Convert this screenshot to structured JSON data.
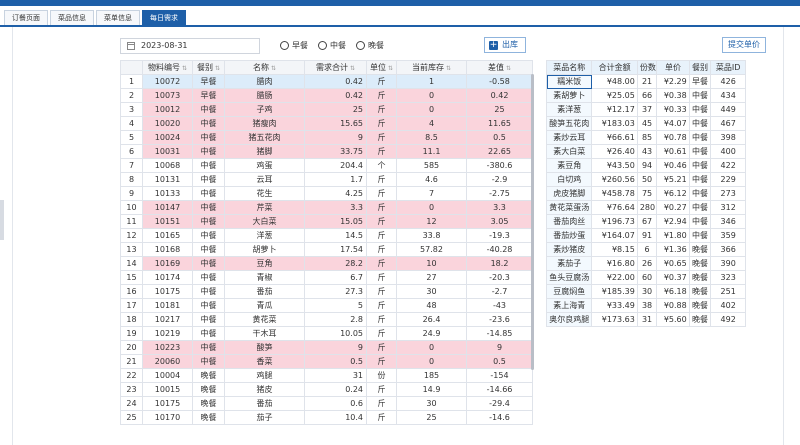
{
  "tabs": [
    {
      "label": "订餐页面"
    },
    {
      "label": "菜品信息"
    },
    {
      "label": "菜单信息"
    },
    {
      "label": "每日需求"
    }
  ],
  "date": {
    "value": "2023-08-31"
  },
  "meals": {
    "options": [
      "早餐",
      "中餐",
      "晚餐"
    ]
  },
  "toolbar": {
    "export_label": "出库",
    "submit_label": "提交单价"
  },
  "colors": {
    "accent": "#1e5fa8",
    "pink_row": "#fad4dc",
    "blue_row": "#dcecfa"
  },
  "demand_table": {
    "columns": [
      "",
      "物料编号",
      "餐别",
      "名称",
      "需求合计",
      "单位",
      "当前库存",
      "差值"
    ],
    "rows": [
      [
        "1",
        "10072",
        "早餐",
        "腊肉",
        "0.42",
        "斤",
        "1",
        "-0.58"
      ],
      [
        "2",
        "10073",
        "早餐",
        "腊肠",
        "0.42",
        "斤",
        "0",
        "0.42"
      ],
      [
        "3",
        "10012",
        "中餐",
        "子鸡",
        "25",
        "斤",
        "0",
        "25"
      ],
      [
        "4",
        "10020",
        "中餐",
        "猪瘦肉",
        "15.65",
        "斤",
        "4",
        "11.65"
      ],
      [
        "5",
        "10024",
        "中餐",
        "猪五花肉",
        "9",
        "斤",
        "8.5",
        "0.5"
      ],
      [
        "6",
        "10031",
        "中餐",
        "猪脚",
        "33.75",
        "斤",
        "11.1",
        "22.65"
      ],
      [
        "7",
        "10068",
        "中餐",
        "鸡蛋",
        "204.4",
        "个",
        "585",
        "-380.6"
      ],
      [
        "8",
        "10131",
        "中餐",
        "云耳",
        "1.7",
        "斤",
        "4.6",
        "-2.9"
      ],
      [
        "9",
        "10133",
        "中餐",
        "花生",
        "4.25",
        "斤",
        "7",
        "-2.75"
      ],
      [
        "10",
        "10147",
        "中餐",
        "芹菜",
        "3.3",
        "斤",
        "0",
        "3.3"
      ],
      [
        "11",
        "10151",
        "中餐",
        "大白菜",
        "15.05",
        "斤",
        "12",
        "3.05"
      ],
      [
        "12",
        "10165",
        "中餐",
        "洋葱",
        "14.5",
        "斤",
        "33.8",
        "-19.3"
      ],
      [
        "13",
        "10168",
        "中餐",
        "胡萝卜",
        "17.54",
        "斤",
        "57.82",
        "-40.28"
      ],
      [
        "14",
        "10169",
        "中餐",
        "豆角",
        "28.2",
        "斤",
        "10",
        "18.2"
      ],
      [
        "15",
        "10174",
        "中餐",
        "青椒",
        "6.7",
        "斤",
        "27",
        "-20.3"
      ],
      [
        "16",
        "10175",
        "中餐",
        "番茄",
        "27.3",
        "斤",
        "30",
        "-2.7"
      ],
      [
        "17",
        "10181",
        "中餐",
        "青瓜",
        "5",
        "斤",
        "48",
        "-43"
      ],
      [
        "18",
        "10217",
        "中餐",
        "黄花菜",
        "2.8",
        "斤",
        "26.4",
        "-23.6"
      ],
      [
        "19",
        "10219",
        "中餐",
        "干木耳",
        "10.05",
        "斤",
        "24.9",
        "-14.85"
      ],
      [
        "20",
        "10223",
        "中餐",
        "酸笋",
        "9",
        "斤",
        "0",
        "9"
      ],
      [
        "21",
        "20060",
        "中餐",
        "香菜",
        "0.5",
        "斤",
        "0",
        "0.5"
      ],
      [
        "22",
        "10004",
        "晚餐",
        "鸡腿",
        "31",
        "份",
        "185",
        "-154"
      ],
      [
        "23",
        "10015",
        "晚餐",
        "猪皮",
        "0.24",
        "斤",
        "14.9",
        "-14.66"
      ],
      [
        "24",
        "10175",
        "晚餐",
        "番茄",
        "0.6",
        "斤",
        "30",
        "-29.4"
      ],
      [
        "25",
        "10170",
        "晚餐",
        "茄子",
        "10.4",
        "斤",
        "25",
        "-14.6"
      ]
    ],
    "row_states": [
      "blue",
      "pink",
      "pink",
      "pink",
      "pink",
      "pink",
      "",
      "",
      "",
      "pink",
      "pink",
      "",
      "",
      "pink",
      "",
      "",
      "",
      "",
      "",
      "pink",
      "pink",
      "",
      "",
      "",
      ""
    ]
  },
  "dish_table": {
    "columns": [
      "菜品名称",
      "合计金额",
      "份数",
      "单价",
      "餐别",
      "菜品ID"
    ],
    "rows": [
      [
        "糯米饭",
        "¥48.00",
        "21",
        "¥2.29",
        "早餐",
        "426"
      ],
      [
        "素胡萝卜",
        "¥25.05",
        "66",
        "¥0.38",
        "中餐",
        "434"
      ],
      [
        "素洋葱",
        "¥12.17",
        "37",
        "¥0.33",
        "中餐",
        "449"
      ],
      [
        "酸笋五花肉",
        "¥183.03",
        "45",
        "¥4.07",
        "中餐",
        "467"
      ],
      [
        "素炒云耳",
        "¥66.61",
        "85",
        "¥0.78",
        "中餐",
        "398"
      ],
      [
        "素大白菜",
        "¥26.40",
        "43",
        "¥0.61",
        "中餐",
        "400"
      ],
      [
        "素豆角",
        "¥43.50",
        "94",
        "¥0.46",
        "中餐",
        "422"
      ],
      [
        "白切鸡",
        "¥260.56",
        "50",
        "¥5.21",
        "中餐",
        "229"
      ],
      [
        "虎皮猪脚",
        "¥458.78",
        "75",
        "¥6.12",
        "中餐",
        "273"
      ],
      [
        "黄花菜蛋汤",
        "¥76.64",
        "280",
        "¥0.27",
        "中餐",
        "312"
      ],
      [
        "番茄肉丝",
        "¥196.73",
        "67",
        "¥2.94",
        "中餐",
        "346"
      ],
      [
        "番茄炒蛋",
        "¥164.07",
        "91",
        "¥1.80",
        "中餐",
        "359"
      ],
      [
        "素炒猪皮",
        "¥8.15",
        "6",
        "¥1.36",
        "晚餐",
        "366"
      ],
      [
        "素茄子",
        "¥16.80",
        "26",
        "¥0.65",
        "晚餐",
        "390"
      ],
      [
        "鱼头豆腐汤",
        "¥22.00",
        "60",
        "¥0.37",
        "晚餐",
        "323"
      ],
      [
        "豆腐焖鱼",
        "¥185.39",
        "30",
        "¥6.18",
        "晚餐",
        "251"
      ],
      [
        "素上海青",
        "¥33.49",
        "38",
        "¥0.88",
        "晚餐",
        "402"
      ],
      [
        "奥尔良鸡腿",
        "¥173.63",
        "31",
        "¥5.60",
        "晚餐",
        "492"
      ]
    ]
  }
}
